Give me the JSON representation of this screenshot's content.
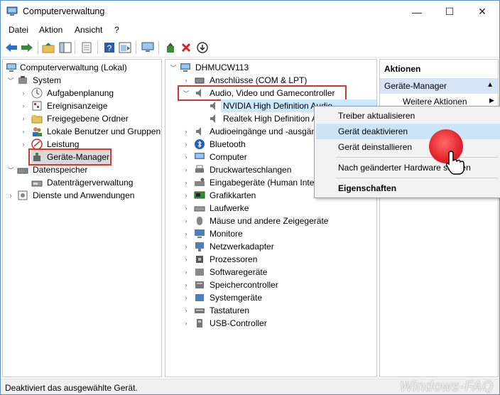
{
  "window": {
    "title": "Computerverwaltung",
    "controls": {
      "minimize": "—",
      "maximize": "☐",
      "close": "✕"
    }
  },
  "menu": [
    "Datei",
    "Aktion",
    "Ansicht",
    "?"
  ],
  "left_tree": {
    "root": "Computerverwaltung (Lokal)",
    "system": "System",
    "items": [
      "Aufgabenplanung",
      "Ereignisanzeige",
      "Freigegebene Ordner",
      "Lokale Benutzer und Gruppen",
      "Leistung",
      "Geräte-Manager"
    ],
    "storage": "Datenspeicher",
    "storage_items": [
      "Datenträgerverwaltung"
    ],
    "services": "Dienste und Anwendungen"
  },
  "device_tree": {
    "computer": "DHMUCW113",
    "categories": [
      "Anschlüsse (COM & LPT)",
      "Audio, Video und Gamecontroller",
      "NVIDIA High Definition Audio",
      "Realtek High Definition Audio",
      "Audioeingänge und -ausgänge",
      "Bluetooth",
      "Computer",
      "Druckwarteschlangen",
      "Eingabegeräte (Human Interface Devices)",
      "Grafikkarten",
      "Laufwerke",
      "Mäuse und andere Zeigegeräte",
      "Monitore",
      "Netzwerkadapter",
      "Prozessoren",
      "Softwaregeräte",
      "Speichercontroller",
      "Systemgeräte",
      "Tastaturen",
      "USB-Controller"
    ]
  },
  "actions": {
    "header": "Aktionen",
    "section": "Geräte-Manager",
    "more": "Weitere Aktionen"
  },
  "context_menu": {
    "items": [
      "Treiber aktualisieren",
      "Gerät deaktivieren",
      "Gerät deinstallieren",
      "Nach geänderter Hardware suchen",
      "Eigenschaften"
    ]
  },
  "status": {
    "text": "Deaktiviert das ausgewählte Gerät.",
    "watermark": "Windows-FAQ"
  },
  "colors": {
    "highlight": "#e0332a",
    "hover": "#cce4f7",
    "section": "#d6e5f5"
  }
}
